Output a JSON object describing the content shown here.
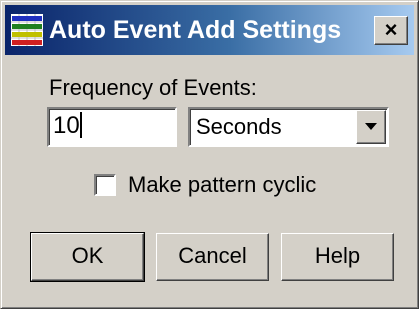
{
  "window": {
    "title": "Auto Event Add Settings",
    "close_glyph": "×",
    "icon": "app-chart-icon"
  },
  "form": {
    "frequency_label": "Frequency of Events:",
    "frequency_value": "10",
    "unit_selected": "Seconds",
    "cyclic_label": "Make pattern cyclic",
    "cyclic_checked": false
  },
  "buttons": {
    "ok": "OK",
    "cancel": "Cancel",
    "help": "Help"
  },
  "colors": {
    "titlebar_start": "#0a246a",
    "titlebar_end": "#a6caf0",
    "face": "#d4d0c8"
  }
}
